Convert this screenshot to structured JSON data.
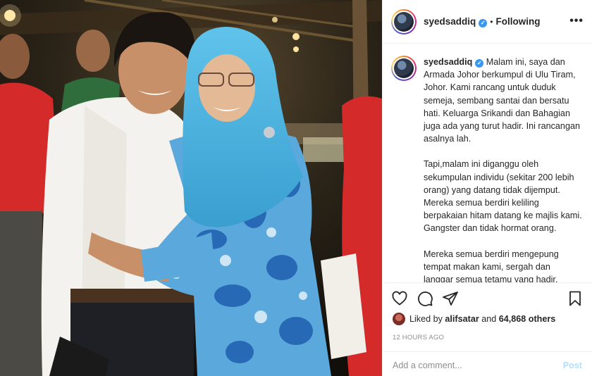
{
  "post": {
    "username": "syedsaddiq",
    "verified_mark": "✓",
    "follow_status": "Following",
    "separator": "•",
    "more_options": "•••"
  },
  "caption": {
    "username": "syedsaddiq",
    "paragraphs": [
      "Malam ini, saya dan Armada Johor berkumpul di Ulu Tiram, Johor. Kami rancang untuk duduk semeja, sembang santai dan bersatu hati. Keluarga Srikandi dan Bahagian juga ada yang turut hadir. Ini rancangan asalnya lah.",
      "Tapi,malam ini diganggu oleh sekumpulan individu (sekitar 200 lebih orang) yang datang tidak dijemput. Mereka semua berdiri keliling berpakaian hitam datang ke majlis kami. Gangster dan tidak hormat orang.",
      "Mereka semua berdiri mengepung tempat makan kami, sergah dan langgar semua tetamu yang hadir."
    ]
  },
  "actions": {
    "icons": [
      "heart-icon",
      "comment-icon",
      "share-icon",
      "bookmark-icon"
    ],
    "liked_prefix": "Liked by",
    "liked_user": "alifsatar",
    "liked_and": "and",
    "liked_count": "64,868 others",
    "timestamp": "12 HOURS AGO"
  },
  "comment": {
    "placeholder": "Add a comment...",
    "post_label": "Post"
  },
  "colors": {
    "verified": "#3897f0",
    "post_disabled": "#b2dffc",
    "muted": "#8e8e8e",
    "shirt_red": "#d42a2a",
    "hijab": "#52b6e0"
  }
}
